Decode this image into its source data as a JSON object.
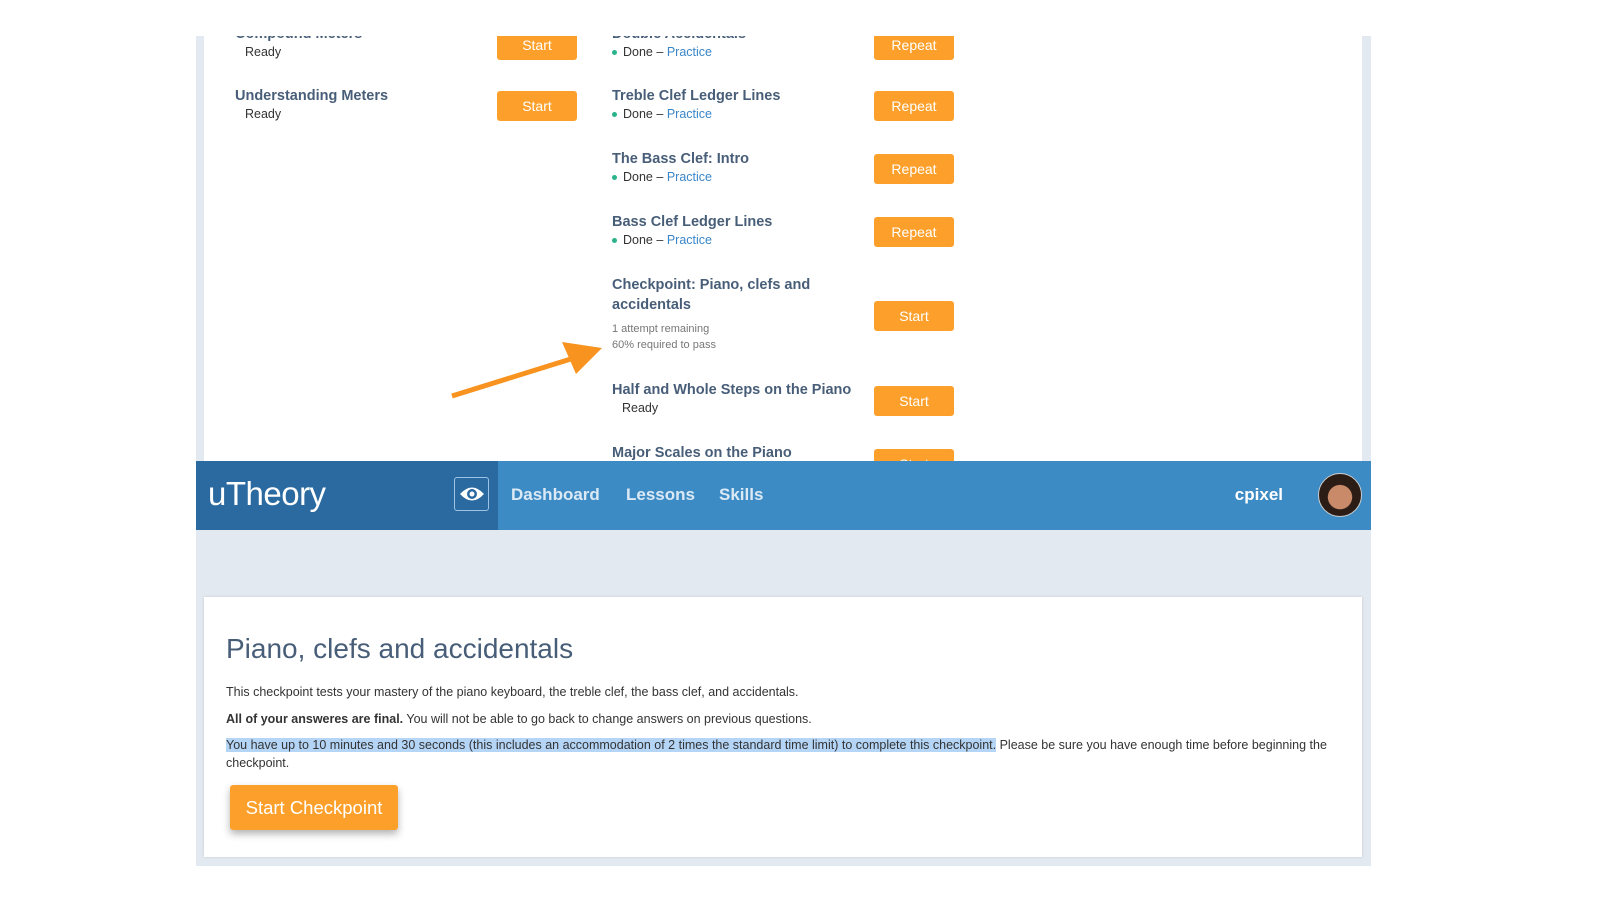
{
  "lessons_left": [
    {
      "title": "Compound Meters",
      "status": "Ready",
      "button": "Start"
    },
    {
      "title": "Understanding Meters",
      "status": "Ready",
      "button": "Start"
    }
  ],
  "lessons_right": [
    {
      "title": "Double Accidentals",
      "status": "Done",
      "link": "Practice",
      "button": "Repeat"
    },
    {
      "title": "Treble Clef Ledger Lines",
      "status": "Done",
      "link": "Practice",
      "button": "Repeat"
    },
    {
      "title": "The Bass Clef: Intro",
      "status": "Done",
      "link": "Practice",
      "button": "Repeat"
    },
    {
      "title": "Bass Clef Ledger Lines",
      "status": "Done",
      "link": "Practice",
      "button": "Repeat"
    },
    {
      "title": "Checkpoint: Piano, clefs and accidentals",
      "attempts": "1 attempt remaining",
      "required": "60% required to pass",
      "button": "Start"
    },
    {
      "title": "Half and Whole Steps on the Piano",
      "status": "Ready",
      "button": "Start"
    },
    {
      "title": "Major Scales on the Piano",
      "button": "Start"
    }
  ],
  "status_separator": "–",
  "annotation": {
    "arrow_color": "#f7931e"
  },
  "nav": {
    "logo": "uTheory",
    "eye_icon": "eye-icon",
    "links": [
      "Dashboard",
      "Lessons",
      "Skills"
    ],
    "username": "cpixel"
  },
  "checkpoint": {
    "title": "Piano, clefs and accidentals",
    "intro": "This checkpoint tests your mastery of the piano keyboard, the treble clef, the bass clef, and accidentals.",
    "final_bold": "All of your answeres are final.",
    "final_rest": " You will not be able to go back to change answers on previous questions.",
    "time_highlighted": "You have up to 10 minutes and 30 seconds (this includes an accommodation of 2 times the standard time limit) to complete this checkpoint.",
    "time_rest": " Please be sure you have enough time before beginning the checkpoint.",
    "start_button": "Start Checkpoint"
  },
  "colors": {
    "accent": "#fca02b",
    "nav": "#3d8bc4",
    "nav_dark": "#2a6aa0",
    "link": "#3a86c8",
    "done_dot": "#2ab38a"
  }
}
